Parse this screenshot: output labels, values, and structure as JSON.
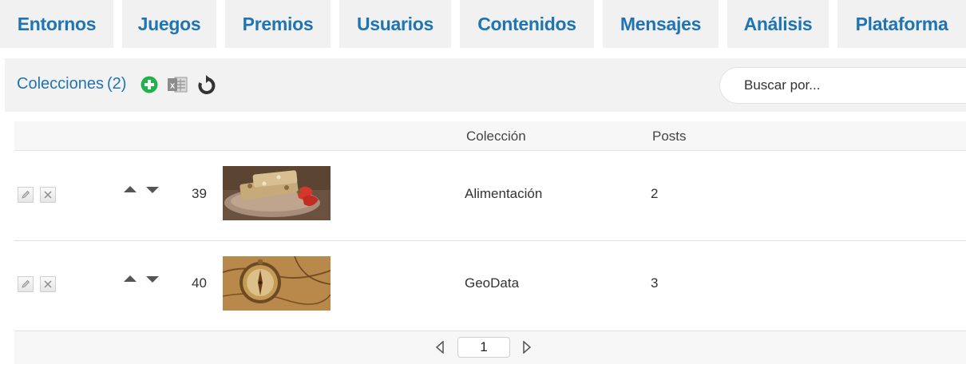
{
  "nav": {
    "tabs": [
      {
        "label": "Entornos"
      },
      {
        "label": "Juegos"
      },
      {
        "label": "Premios"
      },
      {
        "label": "Usuarios"
      },
      {
        "label": "Contenidos"
      },
      {
        "label": "Mensajes"
      },
      {
        "label": "Análisis"
      },
      {
        "label": "Plataforma"
      }
    ]
  },
  "toolbar": {
    "title": "Colecciones",
    "count": "(2)",
    "add_icon": "plus-circle-icon",
    "export_icon": "excel-icon",
    "refresh_icon": "refresh-icon",
    "search_placeholder": "Buscar por..."
  },
  "table": {
    "columns": {
      "collection": "Colección",
      "posts": "Posts"
    },
    "rows": [
      {
        "order": "39",
        "image": "granola-bars-strawberries",
        "collection": "Alimentación",
        "posts": "2"
      },
      {
        "order": "40",
        "image": "compass-on-map",
        "collection": "GeoData",
        "posts": "3"
      }
    ]
  },
  "pagination": {
    "page": "1"
  },
  "colors": {
    "accent": "#1f74b2",
    "add_green": "#22b24c",
    "tab_bg": "#f1f1f1"
  }
}
